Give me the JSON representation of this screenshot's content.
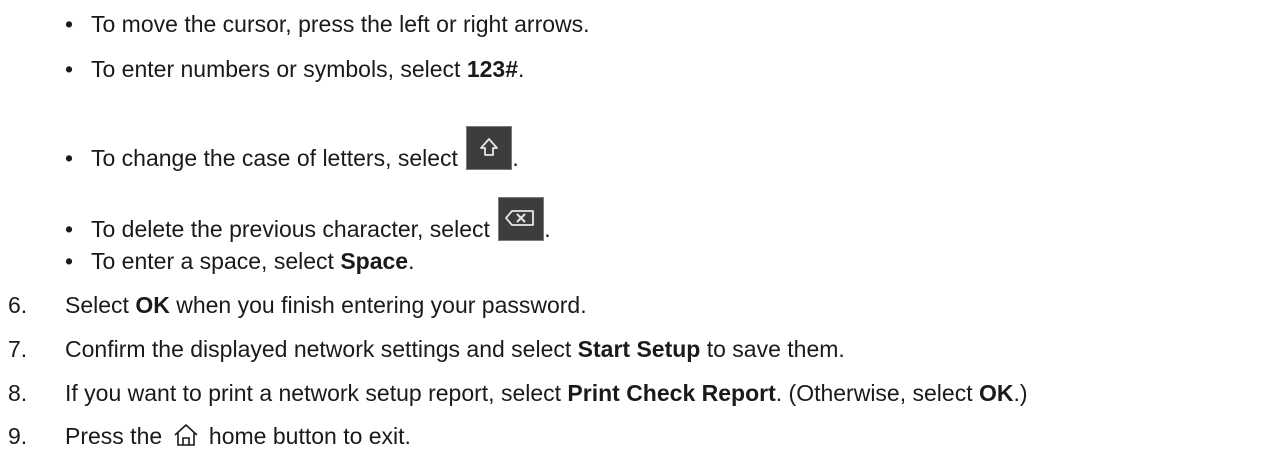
{
  "bullets": [
    {
      "pre": "To move the cursor, press the left or right arrows.",
      "bold": "",
      "post": ""
    },
    {
      "pre": "To enter numbers or symbols, select ",
      "bold": "123#",
      "post": "."
    },
    {
      "pre": "To change the case of letters, select ",
      "icon": "shift-key-icon",
      "post": "."
    },
    {
      "pre": "To delete the previous character, select ",
      "icon": "backspace-key-icon",
      "post": "."
    },
    {
      "pre": "To enter a space, select ",
      "bold": "Space",
      "post": "."
    }
  ],
  "steps": [
    {
      "num": "6.",
      "pre": "Select ",
      "bold": "OK",
      "post": " when you finish entering your password."
    },
    {
      "num": "7.",
      "pre": "Confirm the displayed network settings and select ",
      "bold": "Start Setup",
      "post": " to save them."
    },
    {
      "num": "8.",
      "pre": "If you want to print a network setup report, select ",
      "bold": "Print Check Report",
      "mid": ". (Otherwise, select ",
      "bold2": "OK",
      "post": ".)"
    },
    {
      "num": "9.",
      "pre": "Press the ",
      "icon": "home-icon",
      "post": " home button to exit."
    }
  ],
  "bullet_char": "•"
}
